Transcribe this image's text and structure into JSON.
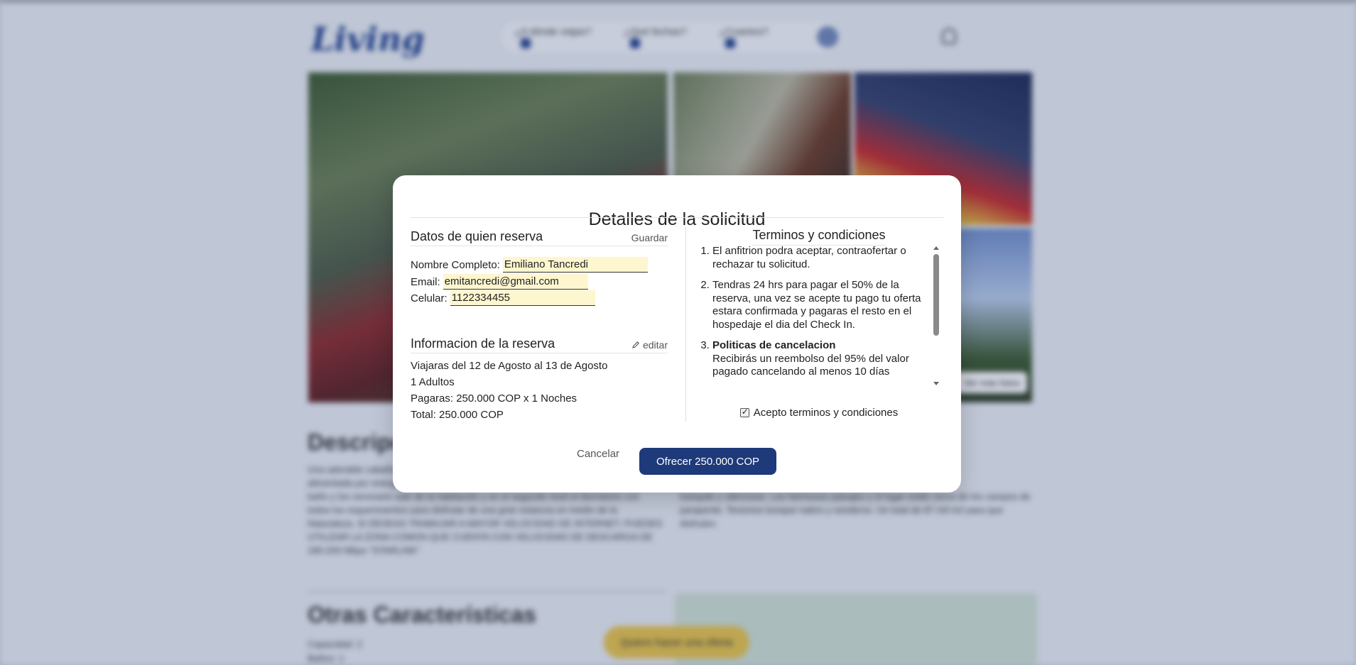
{
  "background": {
    "logo": "Living",
    "search": {
      "where": "¿A dónde viajas?",
      "dates": "¿Qué fechas?",
      "guests": "¿Cuantos?"
    },
    "more_photos": "Ver más fotos",
    "description_title": "Descripción",
    "description_text": "Una adorable cabaña en medio de la naturaleza, en la zona rural de Floresta y alimentada por energía solar. Cuenta con dos niveles: en el primero se encuentra el baño y los necesario salir de la habitación y en el segundo nivel el dormitorio con todos los requerimientos para disfrutar de una gran estancia en medio de la Naturaleza. SI DESEAS TRABAJAR A MAYOR VELOCIDAD DE INTERNET, PUEDES UTILIZAR LA ZONA COMÚN QUE CUENTA CON VELOCIDAD DE DESCARGA DE 180-200 Mbps \"STARLINK\"",
    "right_text": "tranquilo y silencioso. Los hermosos paisajes y el lugar están cerca de los campos de parapente. Tenemos bosque nativo y senderos. Un total de 87 mil m2 para que disfruten.",
    "other_title": "Otras Características",
    "other_items": [
      "Capacidad: 2",
      "Baños: 1"
    ],
    "offer_button": "Quiero hacer una oferta"
  },
  "modal": {
    "title": "Detalles de la solicitud",
    "booker_section": {
      "title": "Datos de quien reserva",
      "save_label": "Guardar",
      "name_label": "Nombre Completo:",
      "name_value": "Emiliano Tancredi",
      "email_label": "Email:",
      "email_value": "emitancredi@gmail.com",
      "phone_label": "Celular:",
      "phone_value": "1122334455"
    },
    "reservation_section": {
      "title": "Informacion de la reserva",
      "edit_label": "editar",
      "dates": "Viajaras del 12 de Agosto al 13 de Agosto",
      "guests": "1 Adultos",
      "price": "Pagaras: 250.000 COP x 1 Noches",
      "total": "Total: 250.000 COP"
    },
    "terms": {
      "title": "Terminos y condiciones",
      "items": [
        {
          "bold": "",
          "text": "El anfitrion podra aceptar, contraofertar o rechazar tu solicitud."
        },
        {
          "bold": "",
          "text": "Tendras 24 hrs para pagar el 50% de la reserva, una vez se acepte tu pago tu oferta estara confirmada y pagaras el resto en el hospedaje el dia del Check In."
        },
        {
          "bold": "Politicas de cancelacion",
          "text": "Recibirás un reembolso del 95% del valor pagado cancelando al menos 10 días"
        }
      ],
      "accept_label": "Acepto terminos y condiciones",
      "accepted": true
    },
    "cancel_label": "Cancelar",
    "offer_label": "Ofrecer 250.000 COP"
  }
}
